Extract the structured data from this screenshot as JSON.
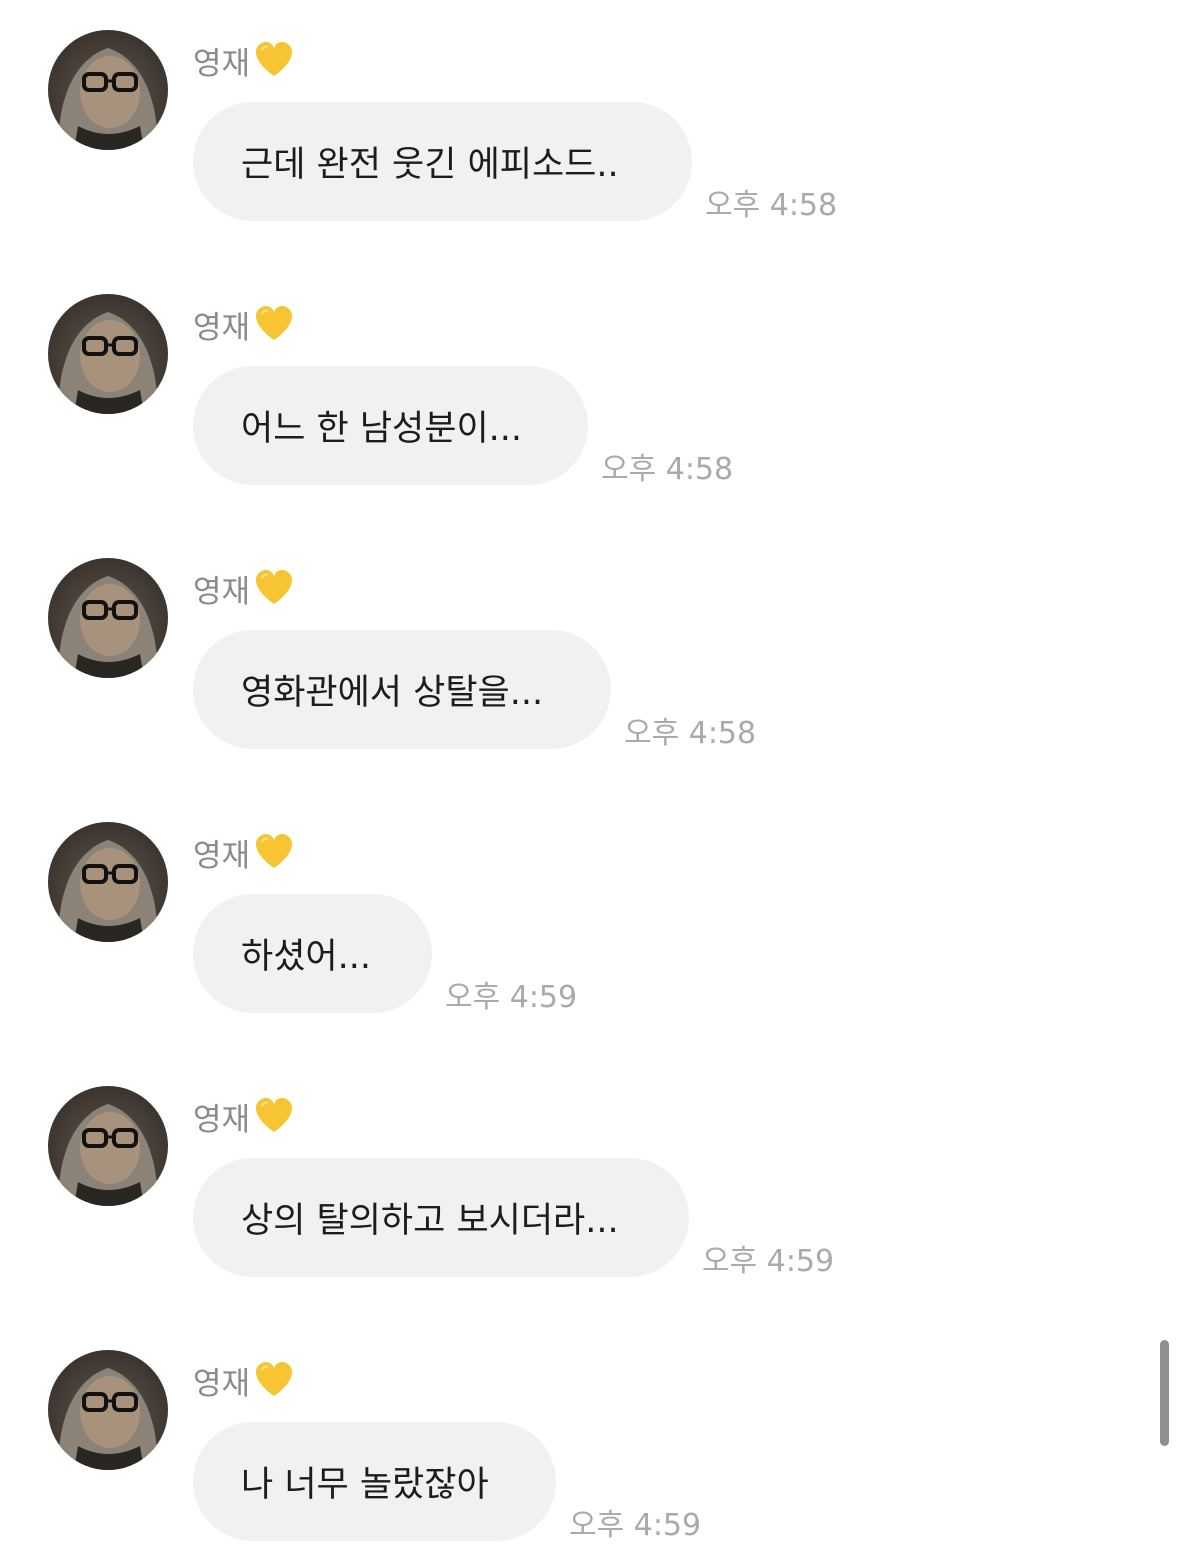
{
  "messages": [
    {
      "sender": "영재",
      "sender_emoji": "yellow-heart-icon",
      "text": "근데 완전 웃긴 에피소드..",
      "time": "오후 4:58"
    },
    {
      "sender": "영재",
      "sender_emoji": "yellow-heart-icon",
      "text": "어느 한 남성분이...",
      "time": "오후 4:58"
    },
    {
      "sender": "영재",
      "sender_emoji": "yellow-heart-icon",
      "text": "영화관에서 상탈을...",
      "time": "오후 4:58"
    },
    {
      "sender": "영재",
      "sender_emoji": "yellow-heart-icon",
      "text": "하셨어...",
      "time": "오후 4:59"
    },
    {
      "sender": "영재",
      "sender_emoji": "yellow-heart-icon",
      "text": "상의 탈의하고 보시더라...",
      "time": "오후 4:59"
    },
    {
      "sender": "영재",
      "sender_emoji": "yellow-heart-icon",
      "text": "나 너무 놀랐잖아",
      "time": "오후 4:59"
    }
  ],
  "colors": {
    "bubble": "#f1f1f3",
    "message_text": "#1c1c1e",
    "sender_name": "#8a8a8f",
    "timestamp": "#a9a9ae",
    "heart": "#f7c531"
  }
}
